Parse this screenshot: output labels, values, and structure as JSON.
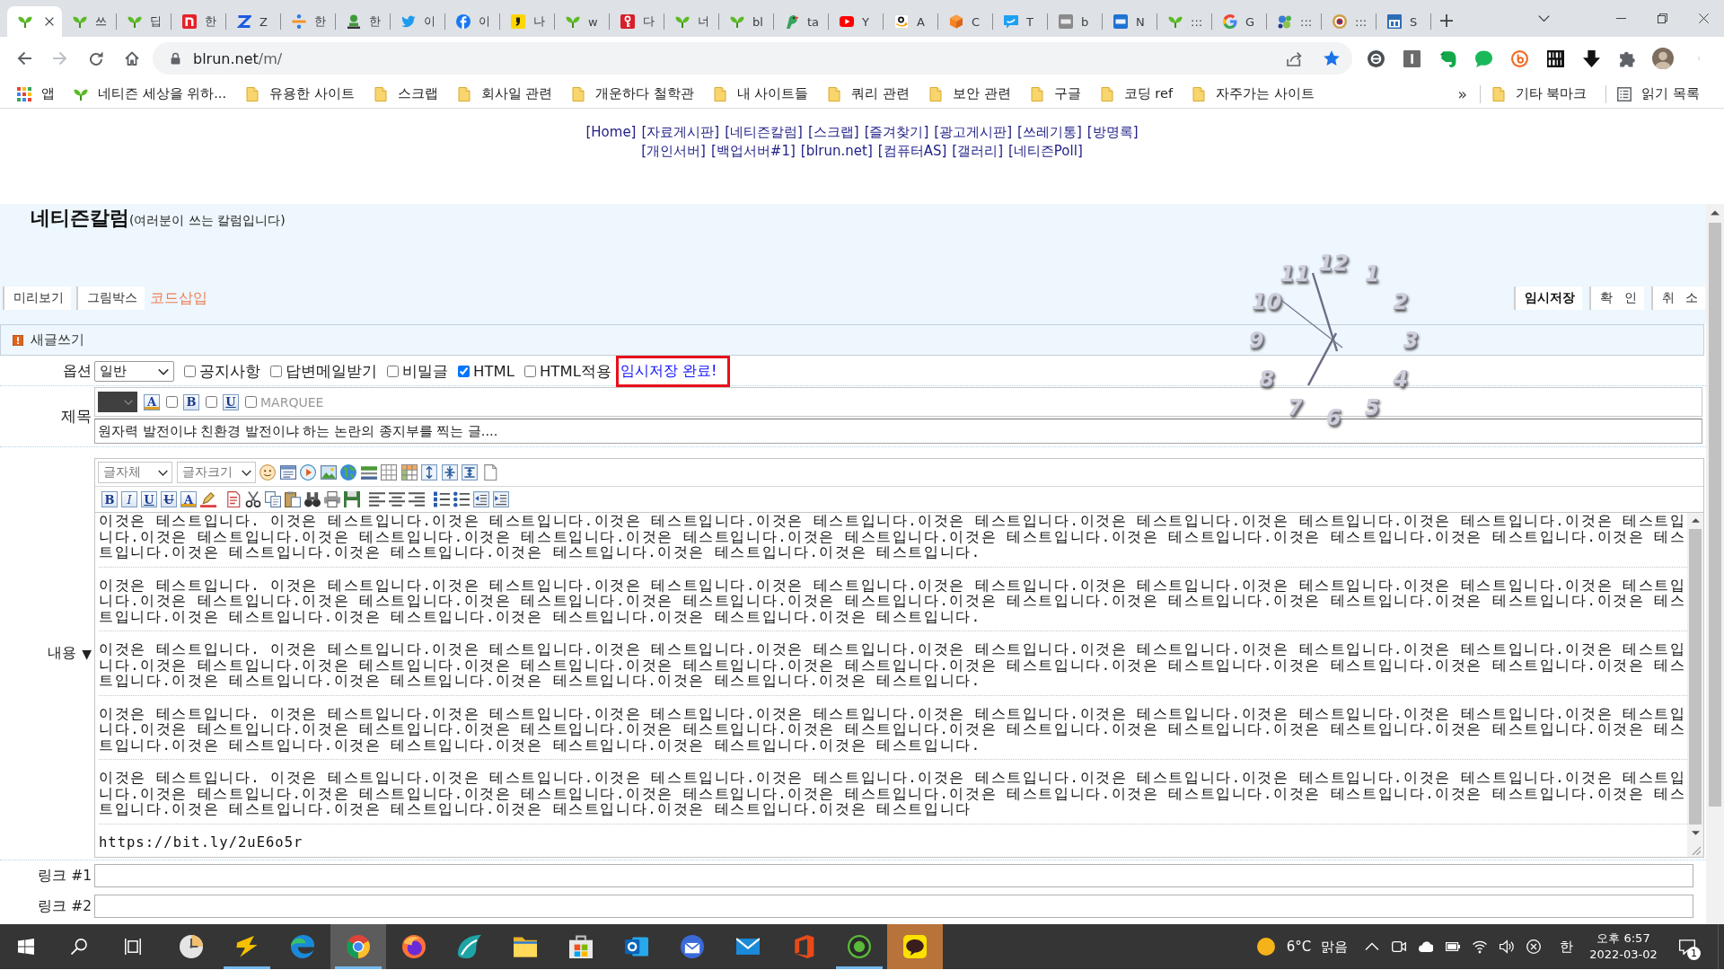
{
  "browser": {
    "tabs": [
      {
        "selected": true
      },
      {
        "label": "쓰",
        "selected": false
      },
      {
        "label": "딥",
        "selected": false
      },
      {
        "label": "한",
        "selected": false
      },
      {
        "label": "Z",
        "selected": false
      },
      {
        "label": "한",
        "selected": false
      },
      {
        "label": "한",
        "selected": false
      },
      {
        "label": "이",
        "selected": false
      },
      {
        "label": "이",
        "selected": false
      },
      {
        "label": "나",
        "selected": false
      },
      {
        "label": "w",
        "selected": false
      },
      {
        "label": "다",
        "selected": false
      },
      {
        "label": "너",
        "selected": false
      },
      {
        "label": "bl",
        "selected": false
      },
      {
        "label": "ta",
        "selected": false
      },
      {
        "label": "Y",
        "selected": false
      },
      {
        "label": "A",
        "selected": false
      },
      {
        "label": "C",
        "selected": false
      },
      {
        "label": "T",
        "selected": false
      },
      {
        "label": "b",
        "selected": false
      },
      {
        "label": "N",
        "selected": false
      },
      {
        "label": ":::",
        "selected": false
      },
      {
        "label": "G",
        "selected": false
      },
      {
        "label": ":::",
        "selected": false
      },
      {
        "label": ":::",
        "selected": false
      },
      {
        "label": "S",
        "selected": false
      }
    ],
    "address": {
      "host": "blrun.net",
      "path": "/m/",
      "bookmarked": true
    },
    "bookmarks": [
      {
        "kind": "apps",
        "label": "앱"
      },
      {
        "kind": "site",
        "label": "네티즌 세상을 위하..."
      },
      {
        "kind": "folder",
        "label": "유용한 사이트"
      },
      {
        "kind": "folder",
        "label": "스크랩"
      },
      {
        "kind": "folder",
        "label": "회사일 관련"
      },
      {
        "kind": "folder",
        "label": "개운하다 철학관"
      },
      {
        "kind": "folder",
        "label": "내 사이트들"
      },
      {
        "kind": "folder",
        "label": "쿼리 관련"
      },
      {
        "kind": "folder",
        "label": "보안 관련"
      },
      {
        "kind": "folder",
        "label": "구글"
      },
      {
        "kind": "folder",
        "label": "코딩 ref"
      },
      {
        "kind": "folder",
        "label": "자주가는 사이트"
      }
    ],
    "bookmarks_overflow": "»",
    "other_bookmarks": "기타 북마크",
    "reading_list": "읽기 목록"
  },
  "site_nav": {
    "links": [
      "[Home]",
      "[자료게시판]",
      "[네티즌칼럼]",
      "[스크랩]",
      "[즐겨찾기]",
      "[광고게시판]",
      "[쓰레기통]",
      "[방명록]",
      "[개인서버]",
      "[백업서버#1]",
      "[blrun.net]",
      "[컴퓨터AS]",
      "[갤러리]",
      "[네티즌Poll]"
    ]
  },
  "board": {
    "title": "네티즌칼럼",
    "subtitle": "(여러분이 쓰는 칼럼입니다)",
    "left_buttons": [
      {
        "kind": "button",
        "label": "미리보기"
      },
      {
        "kind": "button",
        "label": "그림박스"
      },
      {
        "kind": "link",
        "label": "코드삽입"
      }
    ],
    "right_buttons": [
      {
        "label": "임시저장",
        "primary": true
      },
      {
        "label": "확 인",
        "primary": false
      },
      {
        "label": "취 소",
        "primary": false
      }
    ],
    "section": "새글쓰기",
    "options": {
      "label": "옵션",
      "category": "일반",
      "checkboxes": [
        {
          "label": "공지사항",
          "checked": false
        },
        {
          "label": "답변메일받기",
          "checked": false
        },
        {
          "label": "비밀글",
          "checked": false
        },
        {
          "label": "HTML",
          "checked": true
        },
        {
          "label": "HTML적용",
          "checked": false
        }
      ],
      "status": {
        "text": "임시저장 완료!",
        "highlighted": true
      }
    },
    "subject": {
      "label": "제목",
      "format_tools": [
        {
          "kind": "color",
          "glyph": "A"
        },
        {
          "kind": "checkbox",
          "checked": false
        },
        {
          "kind": "bold",
          "glyph": "B"
        },
        {
          "kind": "checkbox",
          "checked": false
        },
        {
          "kind": "underline",
          "glyph": "U"
        },
        {
          "kind": "checkbox",
          "checked": false,
          "label": "MARQUEE"
        }
      ],
      "value": "원자력 발전이냐 친환경 발전이냐 하는 논란의 종지부를 찍는 글...."
    },
    "content": {
      "label": "내용",
      "toggle": "▼",
      "font_select": "글자체",
      "size_select": "글자크기",
      "glyphs": [
        {
          "kind": "bold",
          "glyph": "B"
        },
        {
          "kind": "italic",
          "glyph": "I"
        },
        {
          "kind": "underline",
          "glyph": "U"
        },
        {
          "kind": "strike",
          "glyph": "U"
        },
        {
          "kind": "color",
          "glyph": "A"
        }
      ],
      "paragraphs": [
        {
          "lines": [
            "이것은 테스트입니다. 이것은 테스트입니다.이것은 테스트입니다.이것은 테스트입니다.이것은 테스트입니다.이것은 테스트입니다.이것은 테스트입니다.이것은 테스트입니다.이것은 테스트입니다.이것은 테스트입",
            "니다.이것은 테스트입니다.이것은 테스트입니다.이것은 테스트입니다.이것은 테스트입니다.이것은 테스트입니다.이것은 테스트입니다.이것은 테스트입니다.이것은 테스트입니다.이것은 테스트입니다.이것은 테스",
            "트입니다.이것은 테스트입니다.이것은 테스트입니다.이것은 테스트입니다.이것은 테스트입니다.이것은 테스트입니다."
          ]
        },
        {
          "lines": [
            "이것은 테스트입니다. 이것은 테스트입니다.이것은 테스트입니다.이것은 테스트입니다.이것은 테스트입니다.이것은 테스트입니다.이것은 테스트입니다.이것은 테스트입니다.이것은 테스트입니다.이것은 테스트입",
            "니다.이것은 테스트입니다.이것은 테스트입니다.이것은 테스트입니다.이것은 테스트입니다.이것은 테스트입니다.이것은 테스트입니다.이것은 테스트입니다.이것은 테스트입니다.이것은 테스트입니다.이것은 테스",
            "트입니다.이것은 테스트입니다.이것은 테스트입니다.이것은 테스트입니다.이것은 테스트입니다.이것은 테스트입니다."
          ]
        },
        {
          "lines": [
            "이것은 테스트입니다. 이것은 테스트입니다.이것은 테스트입니다.이것은 테스트입니다.이것은 테스트입니다.이것은 테스트입니다.이것은 테스트입니다.이것은 테스트입니다.이것은 테스트입니다.이것은 테스트입",
            "니다.이것은 테스트입니다.이것은 테스트입니다.이것은 테스트입니다.이것은 테스트입니다.이것은 테스트입니다.이것은 테스트입니다.이것은 테스트입니다.이것은 테스트입니다.이것은 테스트입니다.이것은 테스",
            "트입니다.이것은 테스트입니다.이것은 테스트입니다.이것은 테스트입니다.이것은 테스트입니다.이것은 테스트입니다."
          ]
        },
        {
          "lines": [
            "이것은 테스트입니다. 이것은 테스트입니다.이것은 테스트입니다.이것은 테스트입니다.이것은 테스트입니다.이것은 테스트입니다.이것은 테스트입니다.이것은 테스트입니다.이것은 테스트입니다.이것은 테스트입",
            "니다.이것은 테스트입니다.이것은 테스트입니다.이것은 테스트입니다.이것은 테스트입니다.이것은 테스트입니다.이것은 테스트입니다.이것은 테스트입니다.이것은 테스트입니다.이것은 테스트입니다.이것은 테스",
            "트입니다.이것은 테스트입니다.이것은 테스트입니다.이것은 테스트입니다.이것은 테스트입니다.이것은 테스트입니다."
          ]
        },
        {
          "lines": [
            "이것은 테스트입니다. 이것은 테스트입니다.이것은 테스트입니다.이것은 테스트입니다.이것은 테스트입니다.이것은 테스트입니다.이것은 테스트입니다.이것은 테스트입니다.이것은 테스트입니다.이것은 테스트입",
            "니다.이것은 테스트입니다.이것은 테스트입니다.이것은 테스트입니다.이것은 테스트입니다.이것은 테스트입니다.이것은 테스트입니다.이것은 테스트입니다.이것은 테스트입니다.이것은 테스트입니다.이것은 테스",
            "트입니다.이것은 테스트입니다.이것은 테스트입니다.이것은 테스트입니다.이것은 테스트입니다.이것은 테스트입니다"
          ]
        }
      ],
      "trailing_text": "https://bit.ly/2uE6o5r"
    },
    "links": [
      {
        "label": "링크 #1"
      },
      {
        "label": "링크 #2"
      }
    ],
    "clock": {
      "numerals": [
        "12",
        "11",
        "1",
        "10",
        "2",
        "9",
        "3",
        "8",
        "4",
        "7",
        "5",
        "6"
      ]
    }
  },
  "taskbar": {
    "apps": [
      {
        "running": false,
        "active": false,
        "flashing": false
      },
      {
        "running": true,
        "active": false,
        "flashing": false
      },
      {
        "running": false,
        "active": false,
        "flashing": false
      },
      {
        "running": true,
        "active": true,
        "flashing": false
      },
      {
        "running": false,
        "active": false,
        "flashing": false
      },
      {
        "running": false,
        "active": false,
        "flashing": false
      },
      {
        "running": false,
        "active": false,
        "flashing": false
      },
      {
        "running": false,
        "active": false,
        "flashing": false
      },
      {
        "running": false,
        "active": false,
        "flashing": false
      },
      {
        "running": false,
        "active": false,
        "flashing": false
      },
      {
        "running": false,
        "active": false,
        "flashing": false
      },
      {
        "running": false,
        "active": false,
        "flashing": false
      },
      {
        "running": true,
        "active": false,
        "flashing": false
      },
      {
        "running": false,
        "active": false,
        "flashing": true
      }
    ],
    "weather": "6°C 맑음",
    "ime": "한",
    "time": "오후 6:57",
    "date": "2022-03-02",
    "notifications": "1"
  }
}
